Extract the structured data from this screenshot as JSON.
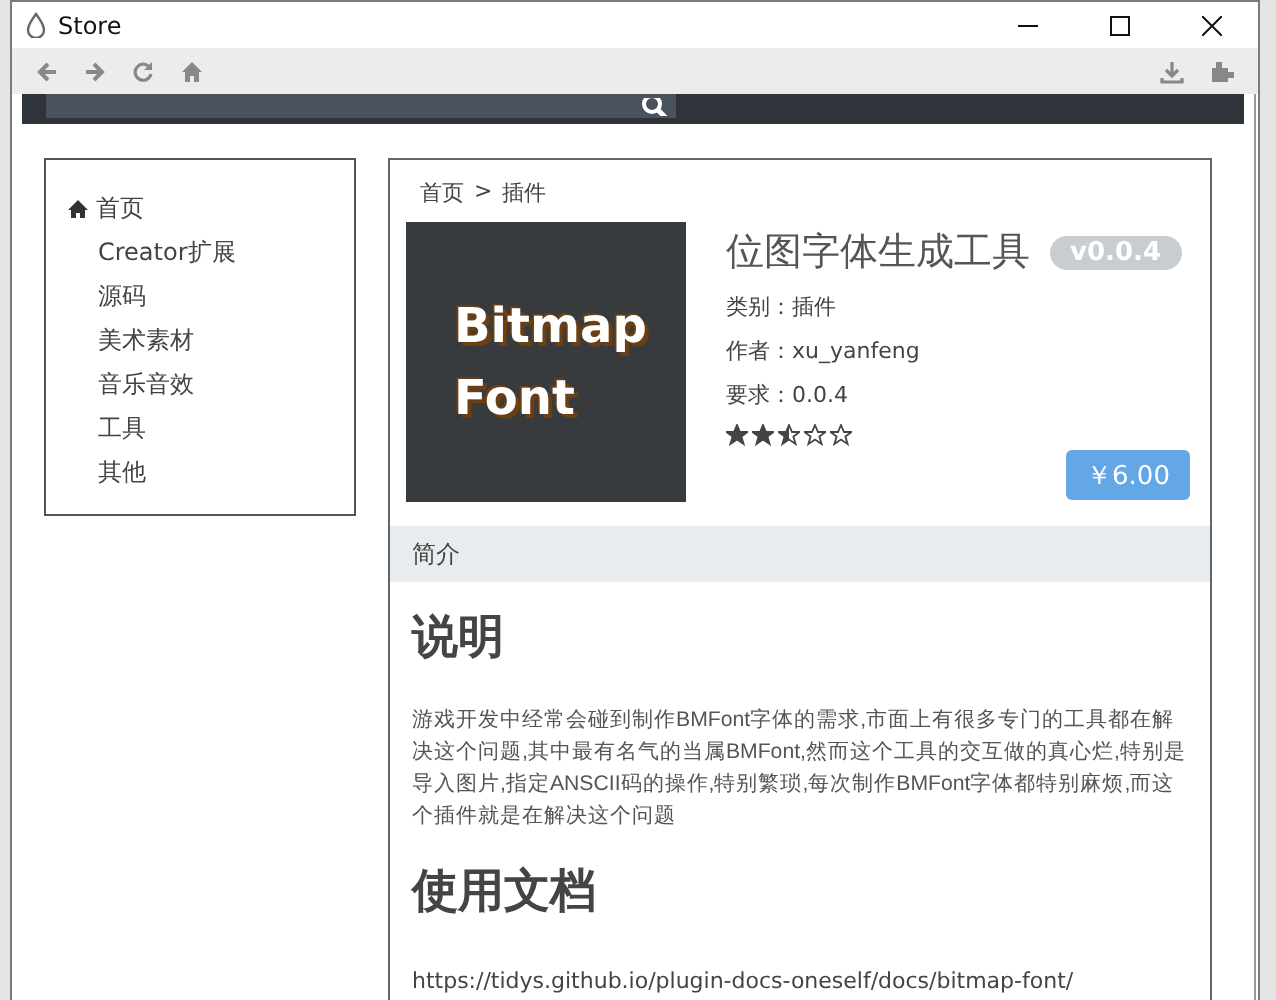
{
  "window": {
    "title": "Store"
  },
  "sidebar": {
    "items": [
      {
        "label": "首页",
        "kind": "home"
      },
      {
        "label": "Creator扩展",
        "kind": "category"
      },
      {
        "label": "源码",
        "kind": "category"
      },
      {
        "label": "美术素材",
        "kind": "category"
      },
      {
        "label": "音乐音效",
        "kind": "category"
      },
      {
        "label": "工具",
        "kind": "category"
      },
      {
        "label": "其他",
        "kind": "category"
      }
    ]
  },
  "breadcrumb": [
    "首页",
    "插件"
  ],
  "breadcrumb_separator": ">",
  "plugin": {
    "icon_lines": [
      "Bitmap",
      "Font"
    ],
    "title": "位图字体生成工具",
    "version": "v0.0.4",
    "fields": [
      {
        "label": "类别：",
        "value": "插件"
      },
      {
        "label": "作者：",
        "value": "xu_yanfeng"
      },
      {
        "label": "要求：",
        "value": "0.0.4"
      }
    ],
    "stars": 2.5,
    "price": "￥6.00"
  },
  "intro": {
    "tab": "简介",
    "blocks": [
      {
        "kind": "heading",
        "text": "说明"
      },
      {
        "kind": "paragraph",
        "text": "游戏开发中经常会碰到制作BMFont字体的需求,市面上有很多专门的工具都在解决这个问题,其中最有名气的当属BMFont,然而这个工具的交互做的真心烂,特别是导入图片,指定ANSCII码的操作,特别繁琐,每次制作BMFont字体都特别麻烦,而这个插件就是在解决这个问题"
      },
      {
        "kind": "heading",
        "text": "使用文档"
      },
      {
        "kind": "link",
        "text": "https://tidys.github.io/plugin-docs-oneself/docs/bitmap-font/"
      }
    ]
  }
}
